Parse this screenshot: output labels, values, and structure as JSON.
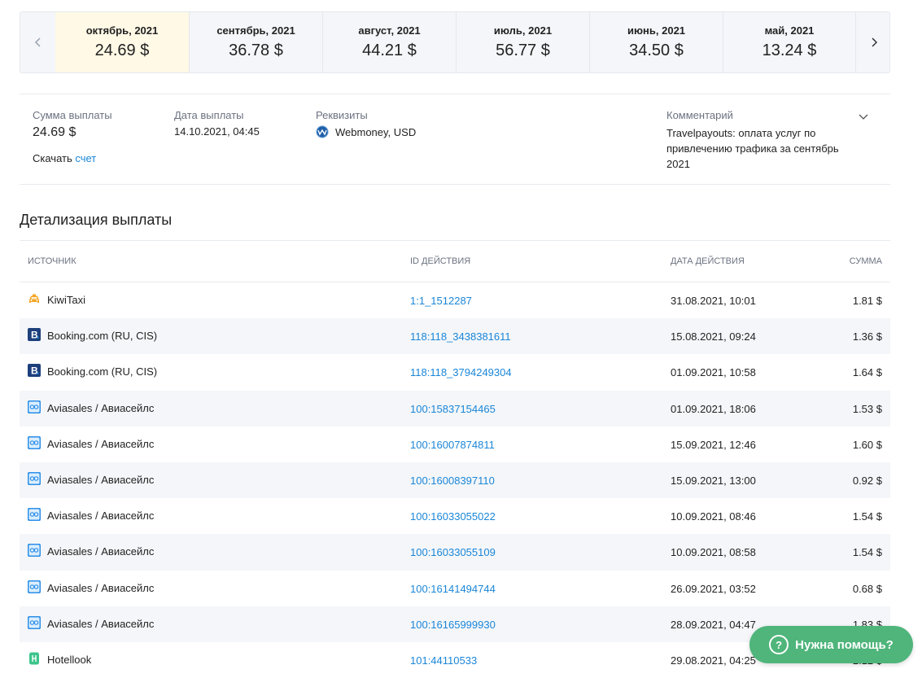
{
  "carousel": {
    "months": [
      {
        "label": "октябрь, 2021",
        "amount": "24.69 $",
        "active": true
      },
      {
        "label": "сентябрь, 2021",
        "amount": "36.78 $",
        "active": false
      },
      {
        "label": "август, 2021",
        "amount": "44.21 $",
        "active": false
      },
      {
        "label": "июль, 2021",
        "amount": "56.77 $",
        "active": false
      },
      {
        "label": "июнь, 2021",
        "amount": "34.50 $",
        "active": false
      },
      {
        "label": "май, 2021",
        "amount": "13.24 $",
        "active": false
      }
    ],
    "prev_icon": "chevron-left-icon",
    "next_icon": "chevron-right-icon"
  },
  "summary": {
    "amount_label": "Сумма выплаты",
    "amount_value": "24.69 $",
    "download_prefix": "Скачать",
    "download_link": "счет",
    "date_label": "Дата выплаты",
    "date_value": "14.10.2021, 04:45",
    "requisites_label": "Реквизиты",
    "requisites_value": "Webmoney, USD",
    "comment_label": "Комментарий",
    "comment_value": "Travelpayouts: оплата услуг по привлечению трафика за сентябрь 2021"
  },
  "details": {
    "title": "Детализация выплаты",
    "columns": {
      "source": "Источник",
      "action_id": "ID действия",
      "action_date": "Дата действия",
      "sum": "Сумма"
    },
    "rows": [
      {
        "icon": "taxi-icon",
        "source": "KiwiTaxi",
        "id": "1:1_1512287",
        "date": "31.08.2021, 10:01",
        "sum": "1.81 $"
      },
      {
        "icon": "booking-icon",
        "source": "Booking.com (RU, CIS)",
        "id": "118:118_3438381611",
        "date": "15.08.2021, 09:24",
        "sum": "1.36 $"
      },
      {
        "icon": "booking-icon",
        "source": "Booking.com (RU, CIS)",
        "id": "118:118_3794249304",
        "date": "01.09.2021, 10:58",
        "sum": "1.64 $"
      },
      {
        "icon": "aviasales-icon",
        "source": "Aviasales / Авиасейлс",
        "id": "100:15837154465",
        "date": "01.09.2021, 18:06",
        "sum": "1.53 $"
      },
      {
        "icon": "aviasales-icon",
        "source": "Aviasales / Авиасейлс",
        "id": "100:16007874811",
        "date": "15.09.2021, 12:46",
        "sum": "1.60 $"
      },
      {
        "icon": "aviasales-icon",
        "source": "Aviasales / Авиасейлс",
        "id": "100:16008397110",
        "date": "15.09.2021, 13:00",
        "sum": "0.92 $"
      },
      {
        "icon": "aviasales-icon",
        "source": "Aviasales / Авиасейлс",
        "id": "100:16033055022",
        "date": "10.09.2021, 08:46",
        "sum": "1.54 $"
      },
      {
        "icon": "aviasales-icon",
        "source": "Aviasales / Авиасейлс",
        "id": "100:16033055109",
        "date": "10.09.2021, 08:58",
        "sum": "1.54 $"
      },
      {
        "icon": "aviasales-icon",
        "source": "Aviasales / Авиасейлс",
        "id": "100:16141494744",
        "date": "26.09.2021, 03:52",
        "sum": "0.68 $"
      },
      {
        "icon": "aviasales-icon",
        "source": "Aviasales / Авиасейлс",
        "id": "100:16165999930",
        "date": "28.09.2021, 04:47",
        "sum": "1.83 $"
      },
      {
        "icon": "hotellook-icon",
        "source": "Hotellook",
        "id": "101:44110533",
        "date": "29.08.2021, 04:25",
        "sum": "2.12 $"
      }
    ]
  },
  "help_button": {
    "label": "Нужна помощь?",
    "icon": "question-icon"
  },
  "colors": {
    "accent_link": "#1a86d8",
    "active_month_bg": "#fff9e6",
    "help_green": "#4fb57b",
    "booking_blue": "#1d3f7c",
    "taxi_yellow": "#f5a623",
    "hotellook_green": "#3cc58c"
  }
}
